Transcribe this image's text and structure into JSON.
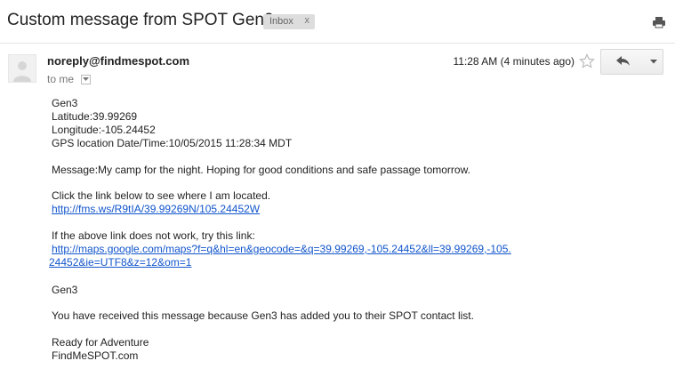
{
  "email": {
    "subject": "Custom message from SPOT Gen3",
    "label": "Inbox",
    "label_remove": "x",
    "sender": "noreply@findmespot.com",
    "recipient": "to me",
    "timestamp": "11:28 AM (4 minutes ago)",
    "body": {
      "device": "Gen3",
      "latitude": "Latitude:39.99269",
      "longitude": "Longitude:-105.24452",
      "gps_time": "GPS location Date/Time:10/05/2015 11:28:34 MDT",
      "message": "Message:My camp for the night. Hoping for good conditions and safe passage tomorrow.",
      "link_intro": "Click the link below to see where I am located.",
      "short_link": "http://fms.ws/R9tIA/39.99269N/105.24452W",
      "fallback_intro": "If the above link does not work, try this link:",
      "maps_link_line1": "http://maps.google.com/maps?f=q&hl=en&geocode=&q=39.99269,-105.24452&ll=39.99269,-105.",
      "maps_link_line2": "24452&ie=UTF8&z=12&om=1",
      "signature_device": "Gen3",
      "notice": "You have received this message because Gen3 has added you to their SPOT contact list.",
      "closing_line1": "Ready for Adventure",
      "closing_line2": "FindMeSPOT.com"
    }
  },
  "icons": {
    "print": "print-icon",
    "star": "star-icon",
    "reply": "reply-icon",
    "more": "chevron-down-icon",
    "avatar": "avatar-placeholder"
  },
  "colors": {
    "link": "#1155cc",
    "label_bg": "#dddddd",
    "muted": "#777777"
  }
}
